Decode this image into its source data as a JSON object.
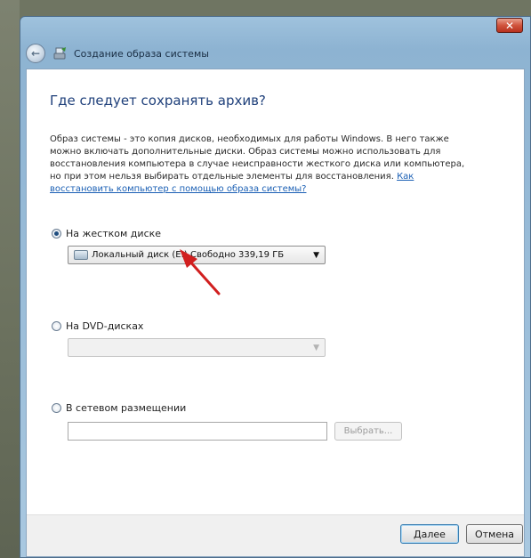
{
  "window": {
    "title": "Создание образа системы",
    "close_label": "✕"
  },
  "page": {
    "heading": "Где следует сохранять архив?",
    "description": "Образ системы - это копия дисков, необходимых для работы Windows. В него также можно включать дополнительные диски. Образ системы можно использовать для восстановления компьютера в случае неисправности жесткого диска или компьютера, но при этом нельзя выбирать отдельные элементы для восстановления.",
    "help_link": "Как восстановить компьютер с помощью образа системы?"
  },
  "options": {
    "hard_disk": {
      "label": "На жестком диске",
      "selected": true,
      "drive_value": "Локальный диск (E:)  Свободно 339,19 ГБ"
    },
    "dvd": {
      "label": "На DVD-дисках",
      "selected": false,
      "drive_value": ""
    },
    "network": {
      "label": "В сетевом размещении",
      "selected": false,
      "path_value": "",
      "browse_label": "Выбрать..."
    }
  },
  "footer": {
    "next_label": "Далее",
    "cancel_label": "Отмена"
  },
  "colors": {
    "accent": "#1e3f7a",
    "link": "#1a5fb4",
    "annotation_arrow": "#d11f1f"
  },
  "icons": [
    "back-arrow-icon",
    "backup-app-icon",
    "drive-icon",
    "chevron-down-icon",
    "close-icon"
  ]
}
